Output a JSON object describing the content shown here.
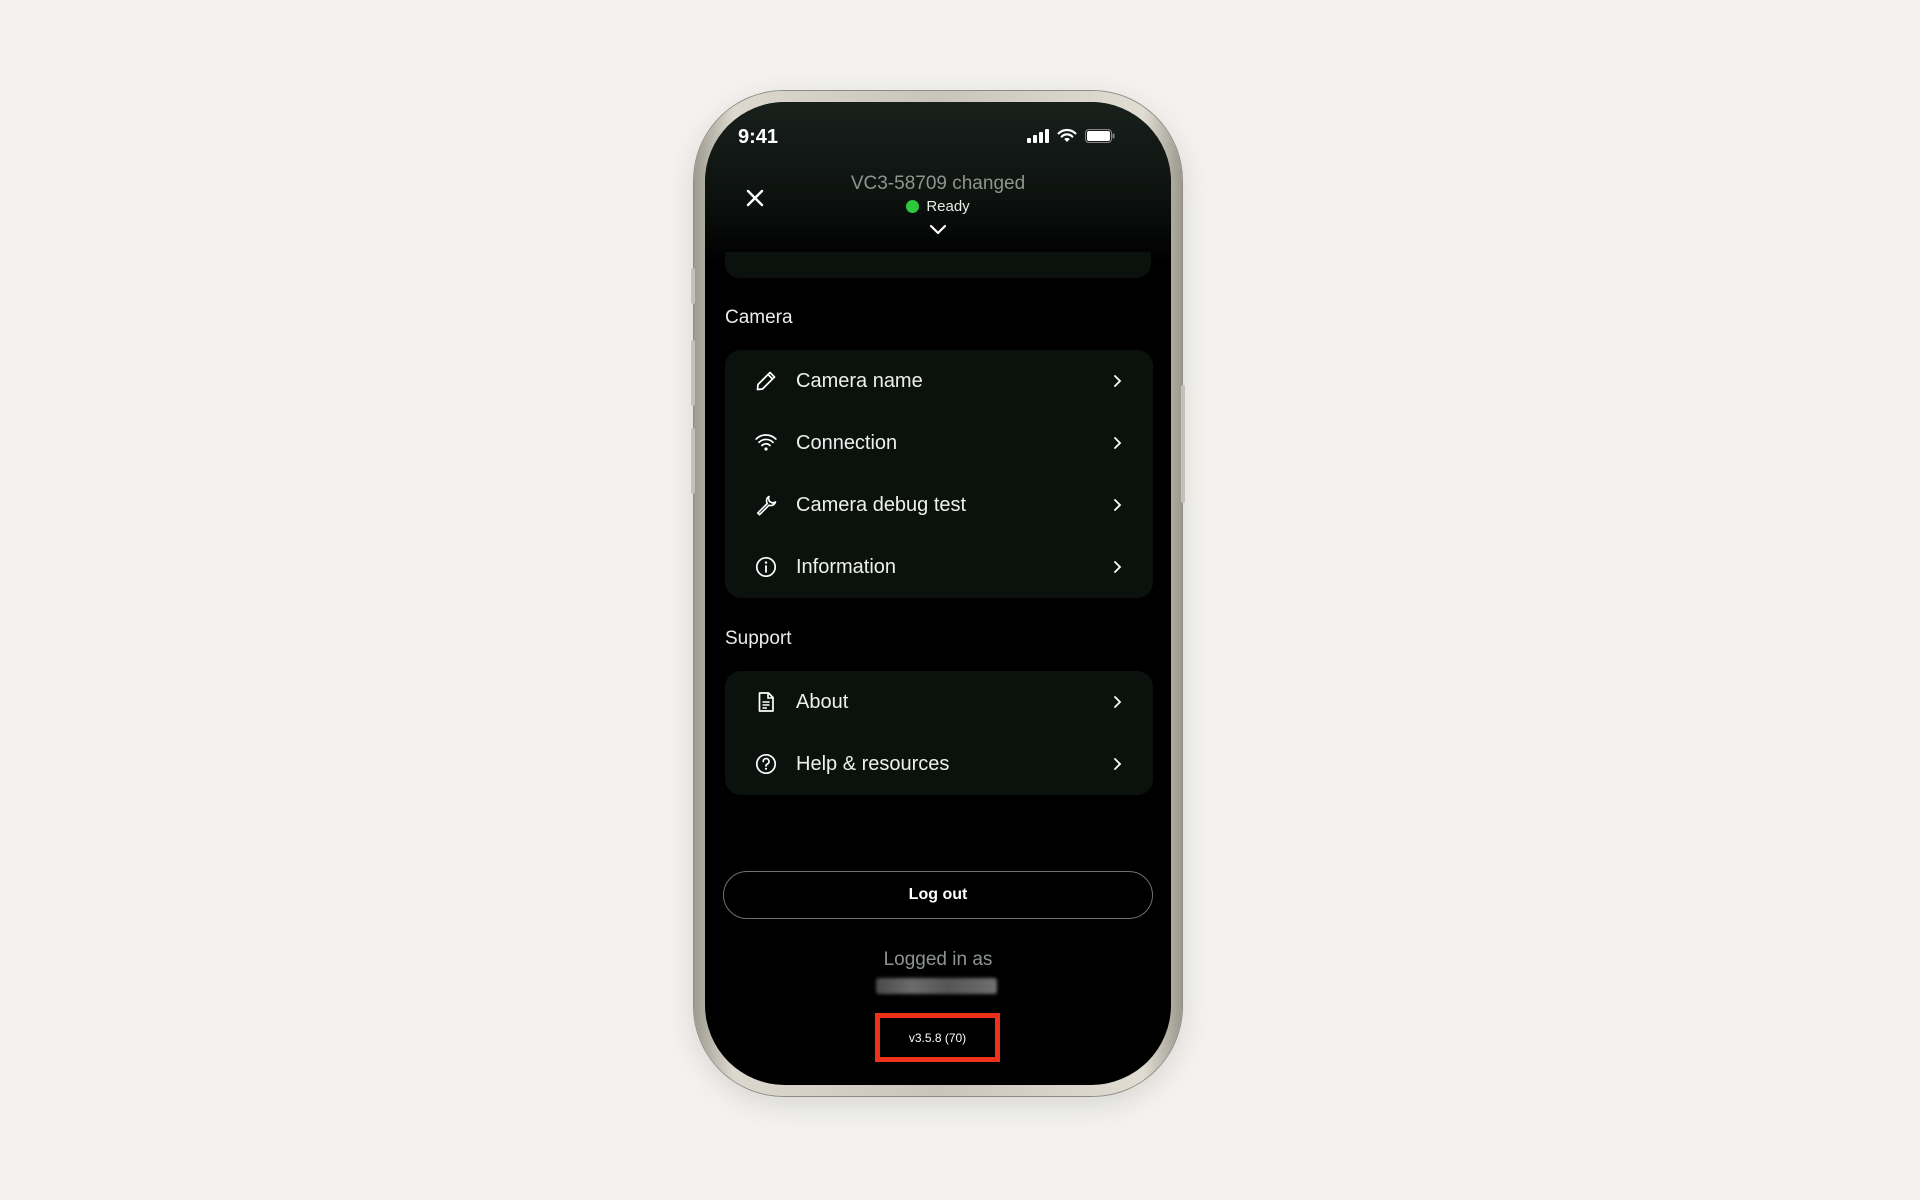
{
  "status_bar": {
    "time": "9:41"
  },
  "header": {
    "title": "VC3-58709 changed",
    "status": "Ready",
    "status_color": "#2ec73e"
  },
  "camera_section": {
    "title": "Camera",
    "items": [
      {
        "label": "Camera name",
        "icon": "pencil-icon"
      },
      {
        "label": "Connection",
        "icon": "wifi-icon"
      },
      {
        "label": "Camera debug test",
        "icon": "wrench-icon"
      },
      {
        "label": "Information",
        "icon": "info-icon"
      }
    ]
  },
  "support_section": {
    "title": "Support",
    "items": [
      {
        "label": "About",
        "icon": "document-icon"
      },
      {
        "label": "Help & resources",
        "icon": "help-circle-icon"
      }
    ]
  },
  "logout_label": "Log out",
  "logged_in_label": "Logged in as",
  "version": "v3.5.8 (70)",
  "colors": {
    "highlight_box": "#f0311a",
    "background": "#f3f2ee"
  }
}
